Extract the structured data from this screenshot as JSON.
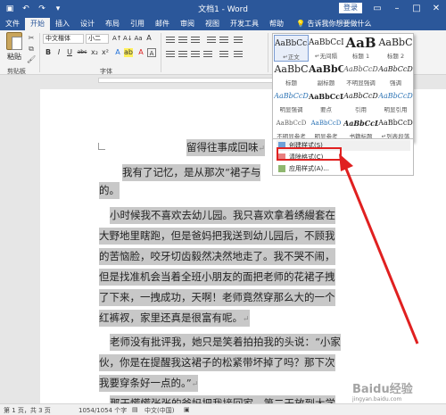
{
  "window": {
    "title": "文档1 - Word",
    "login": "登录"
  },
  "tabs": [
    "文件",
    "开始",
    "插入",
    "设计",
    "布局",
    "引用",
    "邮件",
    "审阅",
    "视图",
    "开发工具",
    "帮助"
  ],
  "active_tab": "开始",
  "tell_me": "告诉我你想要做什么",
  "ribbon": {
    "paste_label": "粘贴",
    "clipboard_group": "剪贴板",
    "font_group": "字体",
    "font_name": "中文楷体",
    "font_size": "小二",
    "format_buttons": [
      "B",
      "I",
      "U",
      "abc",
      "x₂",
      "x²"
    ]
  },
  "styles": [
    {
      "preview": "AaBbCcD",
      "name": "↵正文"
    },
    {
      "preview": "AaBbCcD",
      "name": "↵无间隔"
    },
    {
      "preview": "AaB",
      "name": "标题 1"
    },
    {
      "preview": "AaBbC",
      "name": "标题 2"
    },
    {
      "preview": "AaBbC",
      "name": "标题"
    },
    {
      "preview": "AaBbC",
      "name": "副标题"
    },
    {
      "preview": "AaBbCcD",
      "name": "不明显强调"
    },
    {
      "preview": "AaBbCcD",
      "name": "强调"
    },
    {
      "preview": "AaBbCcD",
      "name": "明显强调"
    },
    {
      "preview": "AaBbCcD",
      "name": "要点"
    },
    {
      "preview": "AaBbCcD",
      "name": "引用"
    },
    {
      "preview": "AaBbCcD",
      "name": "明显引用"
    },
    {
      "preview": "AaBbCcD",
      "name": "不明显参考"
    },
    {
      "preview": "AaBbCcD",
      "name": "明显参考"
    },
    {
      "preview": "AaBbCcD",
      "name": "书籍标题"
    },
    {
      "preview": "AaBbCcD",
      "name": "↵列表段落"
    }
  ],
  "style_menu": {
    "create": "创建样式(S)",
    "clear": "清除格式(C)",
    "apply": "应用样式(A)..."
  },
  "document": {
    "title": "留得往事成回味",
    "lines": [
      "我有了记忆，是从那次“裙子与",
      "的。",
      "小时候我不喜欢去幼儿园。我只喜欢拿着绣縵套在",
      "大野地里瞎跑，但是爸妈把我送到幼儿园后，不顾我",
      "的苦恼脸，咬牙切齿毅然决然地走了。我不哭不闹，",
      "但是找准机会当着全班小朋友的面把老师的花裙子拽",
      "了下来，一拽成功，天啊！老师竟然穿那么大的一个",
      "红裤衩，家里还真是很富有呢。",
      "老师没有批评我，她只是笑着拍拍我的头说：“小家",
      "伙，你是在提醒我这裙子的松紧带坏掉了吗？那下次",
      "我要穿条好一点的。”",
      "那天慌慌张张的爸妈把我接回家，第二天放到大学"
    ]
  },
  "status": {
    "page": "第 1 页，共 3 页",
    "words": "1054/1054 个字",
    "language": "中文(中国)"
  },
  "watermark": {
    "text": "Baidu经验",
    "sub": "jingyan.baidu.com"
  }
}
